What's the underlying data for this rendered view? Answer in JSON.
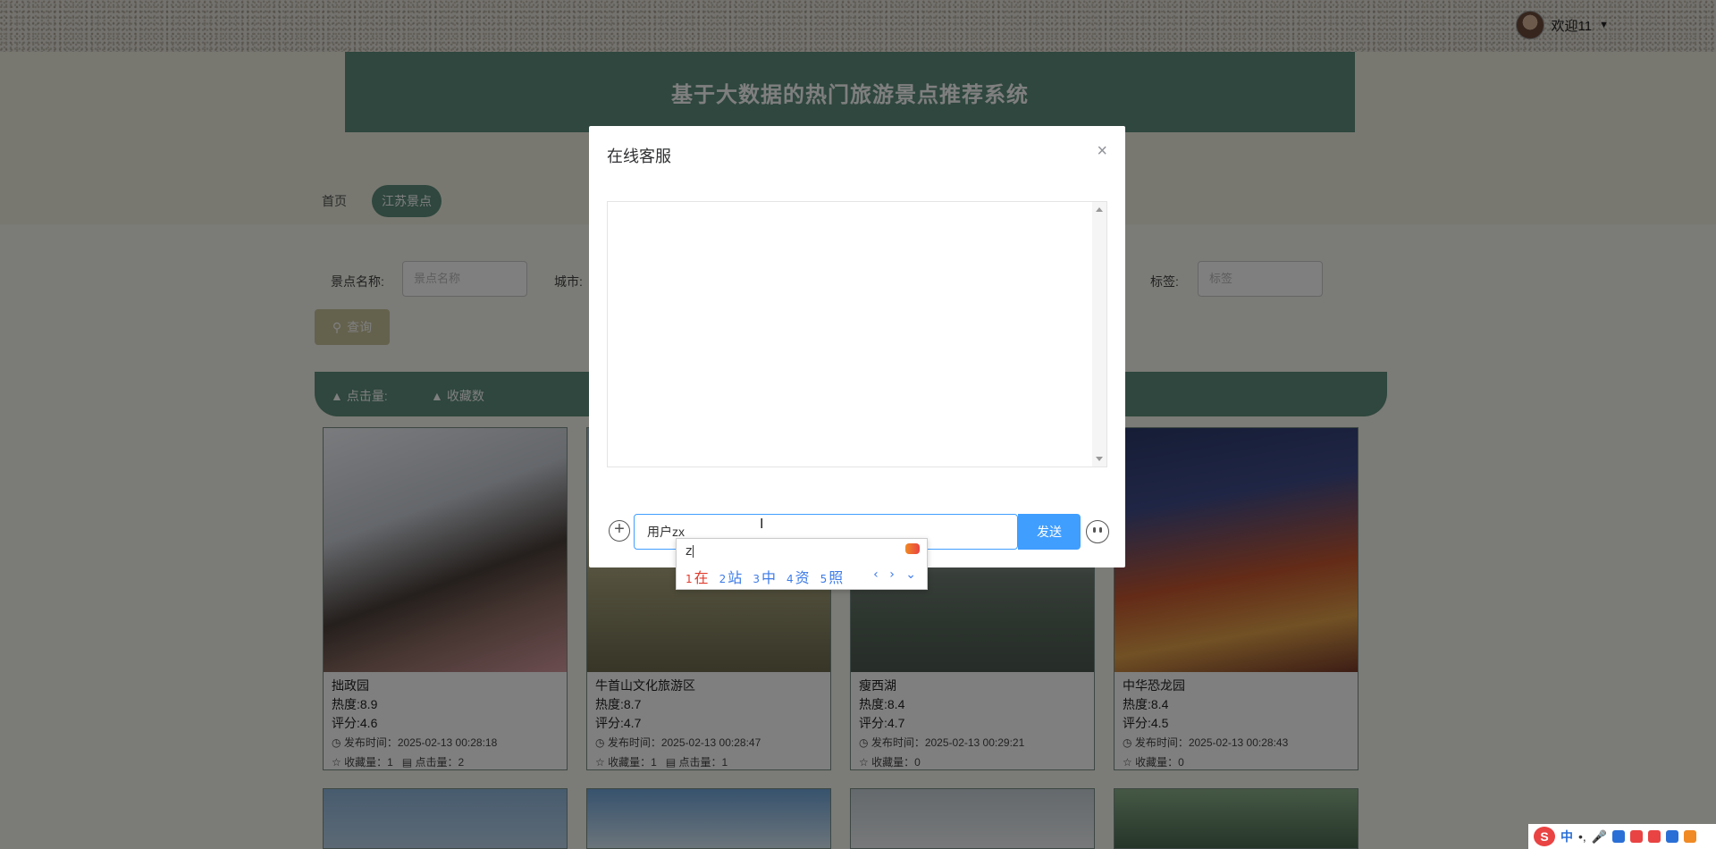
{
  "header": {
    "user_greeting": "欢迎11",
    "caret": "▼"
  },
  "site": {
    "title": "基于大数据的热门旅游景点推荐系统"
  },
  "nav": {
    "items": [
      {
        "label": "首页",
        "active": false
      },
      {
        "label": "江苏景点",
        "active": true
      }
    ]
  },
  "search": {
    "name_label": "景点名称:",
    "name_placeholder": "景点名称",
    "city_label": "城市:",
    "tag_label": "标签:",
    "tag_placeholder": "标签",
    "query_label": "查询"
  },
  "sort": {
    "clicks_label": "点击量:",
    "favorites_label": "收藏数"
  },
  "cards": [
    {
      "name": "拙政园",
      "heat": "热度:8.9",
      "rating": "评分:4.6",
      "publish": "发布时间：2025-02-13 00:28:18",
      "favorites": "收藏量：1",
      "clicks": "点击量：2"
    },
    {
      "name": "牛首山文化旅游区",
      "heat": "热度:8.7",
      "rating": "评分:4.7",
      "publish": "发布时间：2025-02-13 00:28:47",
      "favorites": "收藏量：1",
      "clicks": "点击量：1"
    },
    {
      "name": "瘦西湖",
      "heat": "热度:8.4",
      "rating": "评分:4.7",
      "publish": "发布时间：2025-02-13 00:29:21",
      "favorites": "收藏量：0",
      "clicks": ""
    },
    {
      "name": "中华恐龙园",
      "heat": "热度:8.4",
      "rating": "评分:4.5",
      "publish": "发布时间：2025-02-13 00:28:43",
      "favorites": "收藏量：0",
      "clicks": ""
    }
  ],
  "dialog": {
    "title": "在线客服",
    "close": "×",
    "input_value": "用户zx",
    "send_label": "发送"
  },
  "ime": {
    "composition": "z",
    "candidates": [
      {
        "n": "1",
        "text": "在"
      },
      {
        "n": "2",
        "text": "站"
      },
      {
        "n": "3",
        "text": "中"
      },
      {
        "n": "4",
        "text": "资"
      },
      {
        "n": "5",
        "text": "照"
      }
    ],
    "nav": "‹ › ⌄"
  },
  "tray": {
    "logo": "S",
    "lang": "中"
  },
  "colors": {
    "brand": "#5f8f7d",
    "primary": "#409eff",
    "query_btn": "#c8c29a"
  }
}
